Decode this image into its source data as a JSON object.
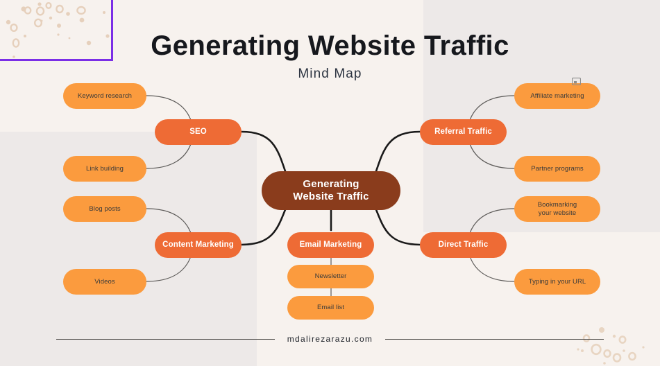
{
  "header": {
    "title": "Generating Website Traffic",
    "subtitle": "Mind Map"
  },
  "center": {
    "line1": "Generating",
    "line2": "Website Traffic"
  },
  "branches": {
    "seo": "SEO",
    "content_marketing": "Content Marketing",
    "email_marketing": "Email Marketing",
    "referral_traffic": "Referral Traffic",
    "direct_traffic": "Direct Traffic"
  },
  "leaves": {
    "keyword_research": "Keyword research",
    "link_building": "Link building",
    "blog_posts": "Blog posts",
    "videos": "Videos",
    "newsletter": "Newsletter",
    "email_list": "Email list",
    "affiliate_marketing": "Affiliate marketing",
    "partner_programs": "Partner programs",
    "bookmarking_line1": "Bookmarking",
    "bookmarking_line2": "your website",
    "typing_url": "Typing in your URL"
  },
  "footer": {
    "text": "mdalirezarazu.com"
  },
  "colors": {
    "background": "#F7F2EE",
    "panel": "#EDE9E8",
    "center_node": "#8A3C1C",
    "branch_node": "#EE6B35",
    "leaf_node": "#FB9B3E",
    "title_text": "#16181D",
    "selection_frame": "#7B2EE6",
    "connector_main": "#1A1A1A",
    "connector_leaf": "#5C5A58",
    "decor_dot": "#E4CEB8"
  }
}
